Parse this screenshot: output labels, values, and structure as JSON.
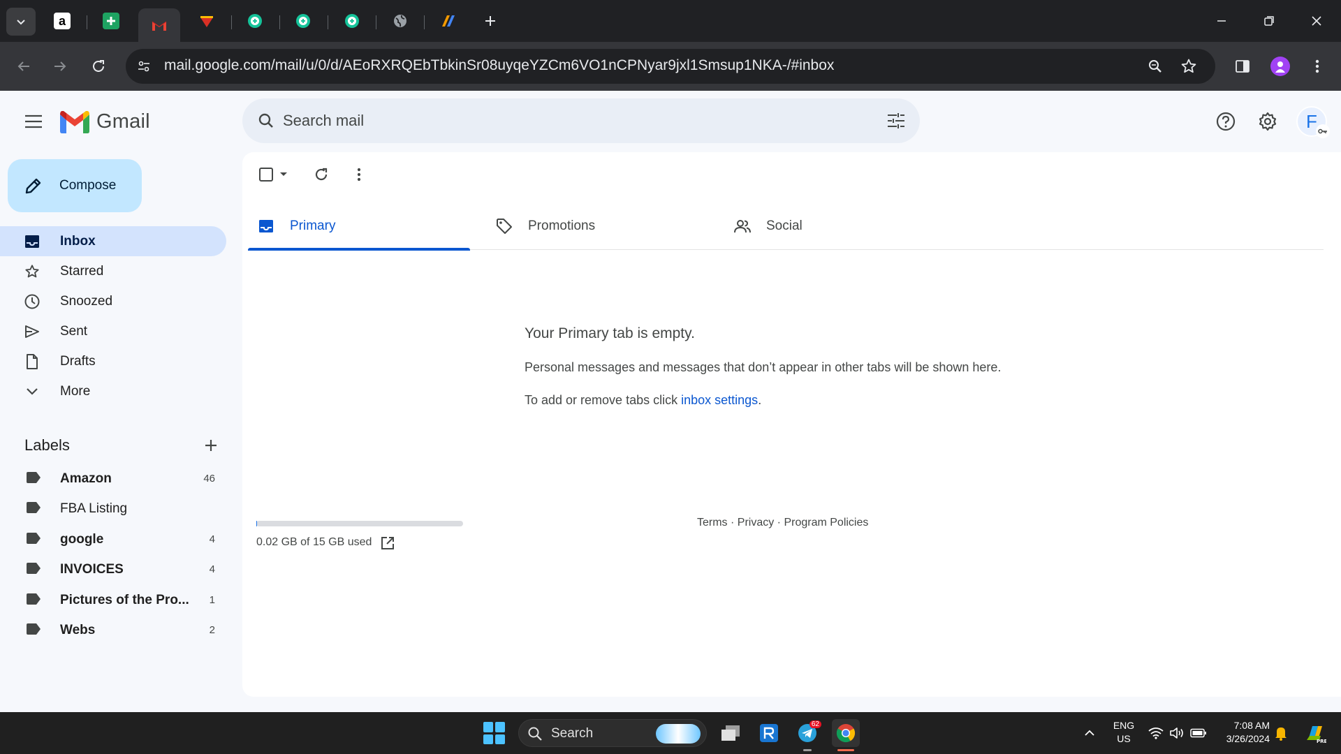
{
  "browser": {
    "tabs": [
      {
        "name": "amazon",
        "icon": "amazon-icon"
      },
      {
        "name": "sheets",
        "icon": "sheets-icon"
      },
      {
        "name": "gmail",
        "icon": "gmail-icon",
        "active": true
      },
      {
        "name": "avatar",
        "icon": "site-icon"
      },
      {
        "name": "grammarly-1",
        "icon": "grammarly-icon"
      },
      {
        "name": "grammarly-2",
        "icon": "grammarly-icon"
      },
      {
        "name": "grammarly-3",
        "icon": "grammarly-icon"
      },
      {
        "name": "globe",
        "icon": "globe-icon"
      },
      {
        "name": "app",
        "icon": "app-icon"
      }
    ],
    "url": "mail.google.com/mail/u/0/d/AEoRXRQEbTbkinSr08uyqeYZCm6VO1nCPNyar9jxl1Smsup1NKA-/#inbox"
  },
  "gmail": {
    "logo_text": "Gmail",
    "search_placeholder": "Search mail",
    "account_initial": "F",
    "compose_label": "Compose",
    "nav": [
      {
        "label": "Inbox",
        "icon": "inbox-icon",
        "active": true
      },
      {
        "label": "Starred",
        "icon": "star-icon"
      },
      {
        "label": "Snoozed",
        "icon": "clock-icon"
      },
      {
        "label": "Sent",
        "icon": "send-icon"
      },
      {
        "label": "Drafts",
        "icon": "draft-icon"
      },
      {
        "label": "More",
        "icon": "chevron-down-icon"
      }
    ],
    "labels_title": "Labels",
    "labels": [
      {
        "name": "Amazon",
        "count": "46",
        "unread": true
      },
      {
        "name": "FBA Listing",
        "count": "",
        "unread": false
      },
      {
        "name": "google",
        "count": "4",
        "unread": true
      },
      {
        "name": "INVOICES",
        "count": "4",
        "unread": true
      },
      {
        "name": "Pictures of the Pro...",
        "count": "1",
        "unread": true
      },
      {
        "name": "Webs",
        "count": "2",
        "unread": true
      }
    ],
    "inbox_tabs": [
      {
        "label": "Primary",
        "icon": "inbox-icon",
        "active": true
      },
      {
        "label": "Promotions",
        "icon": "tag-icon"
      },
      {
        "label": "Social",
        "icon": "people-icon"
      }
    ],
    "empty": {
      "title": "Your Primary tab is empty.",
      "description": "Personal messages and messages that don’t appear in other tabs will be shown here.",
      "settings_prefix": "To add or remove tabs click ",
      "settings_link": "inbox settings",
      "settings_suffix": "."
    },
    "storage": {
      "text": "0.02 GB of 15 GB used",
      "used_fraction": 0.0013
    },
    "footer": {
      "terms": "Terms",
      "privacy": "Privacy",
      "policies": "Program Policies",
      "separator": " · "
    }
  },
  "taskbar": {
    "search_label": "Search",
    "telegram_badge": "62",
    "lang_line1": "ENG",
    "lang_line2": "US",
    "time": "7:08 AM",
    "date": "3/26/2024"
  },
  "colors": {
    "accent": "#0b57d0",
    "compose_bg": "#c2e7ff",
    "nav_active_bg": "#d3e3fd",
    "page_bg": "#f6f8fc"
  }
}
